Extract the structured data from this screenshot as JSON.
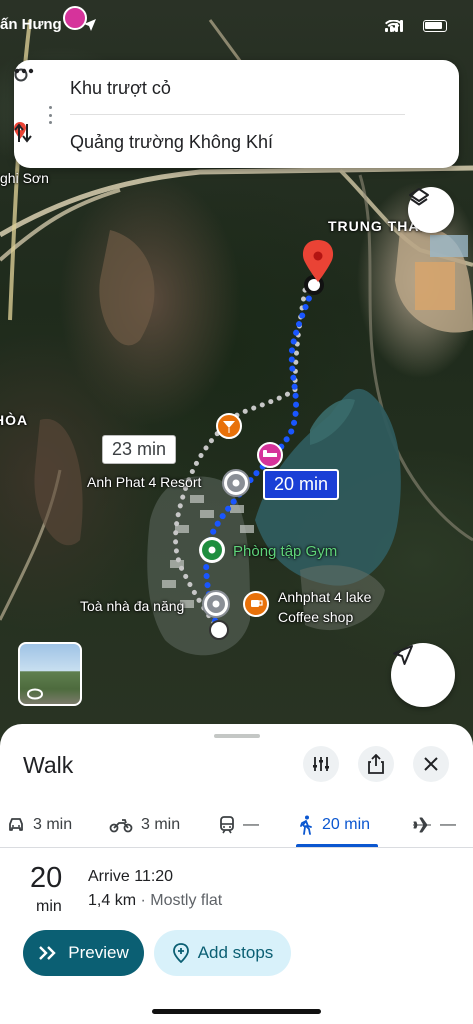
{
  "status": {
    "left_text": "ấn Hưng"
  },
  "route": {
    "origin": "Khu trượt cỏ",
    "destination": "Quảng trường Không Khí"
  },
  "map": {
    "labels": {
      "trung_thanh": "TRUNG THÀNH",
      "hoa": "HÒA",
      "nghi_son": "ghi Sơn",
      "anh_phat_resort": "Anh Phat 4 Resort",
      "phong_tap_gym": "Phòng tập Gym",
      "toa_nha": "Toà nhà đa năng",
      "coffee_line1": "Anhphat 4 lake",
      "coffee_line2": "Coffee shop"
    },
    "alt_time": "23 min",
    "main_time": "20 min"
  },
  "sheet": {
    "title": "Walk",
    "modes": [
      {
        "icon": "car-icon",
        "label": "3 min"
      },
      {
        "icon": "motorbike-icon",
        "label": "3 min"
      },
      {
        "icon": "train-icon",
        "label": "—"
      },
      {
        "icon": "walk-icon",
        "label": "20 min"
      },
      {
        "icon": "plane-icon",
        "label": "—"
      }
    ],
    "duration": "20",
    "duration_unit": "min",
    "arrive": "Arrive 11:20",
    "distance": "1,4 km",
    "terrain": " · Mostly flat",
    "preview_label": "Preview",
    "add_stops_label": "Add stops"
  },
  "colors": {
    "accent": "#0b57d0",
    "preview_bg": "#0b5f73",
    "route_blue": "#1a56ff",
    "pin_red": "#ea4335"
  }
}
